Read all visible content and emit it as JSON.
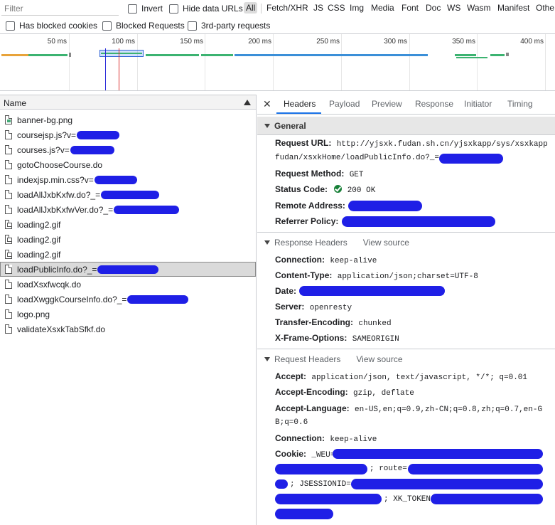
{
  "toolbar": {
    "filter_placeholder": "Filter",
    "invert_label": "Invert",
    "hide_data_urls_label": "Hide data URLs",
    "types": [
      "All",
      "Fetch/XHR",
      "JS",
      "CSS",
      "Img",
      "Media",
      "Font",
      "Doc",
      "WS",
      "Wasm",
      "Manifest",
      "Othe"
    ],
    "active_type": "All",
    "has_blocked_cookies_label": "Has blocked cookies",
    "blocked_requests_label": "Blocked Requests",
    "third_party_label": "3rd-party requests"
  },
  "overview": {
    "ticks": [
      "50 ms",
      "100 ms",
      "150 ms",
      "200 ms",
      "250 ms",
      "300 ms",
      "350 ms",
      "400 ms"
    ]
  },
  "request_list": {
    "column_name": "Name",
    "rows": [
      {
        "name": "banner-bg.png",
        "icon": "image-file-icon"
      },
      {
        "name": "coursejsp.js?v=",
        "icon": "file-icon"
      },
      {
        "name": "courses.js?v=",
        "icon": "file-icon"
      },
      {
        "name": "gotoChooseCourse.do",
        "icon": "file-icon"
      },
      {
        "name": "indexjsp.min.css?v=",
        "icon": "file-icon"
      },
      {
        "name": "loadAllJxbKxfw.do?_=",
        "icon": "file-icon"
      },
      {
        "name": "loadAllJxbKxfwVer.do?_=",
        "icon": "file-icon"
      },
      {
        "name": "loading2.gif",
        "icon": "gif-file-icon"
      },
      {
        "name": "loading2.gif",
        "icon": "gif-file-icon"
      },
      {
        "name": "loading2.gif",
        "icon": "gif-file-icon"
      },
      {
        "name": "loadPublicInfo.do?_=",
        "icon": "file-icon"
      },
      {
        "name": "loadXsxfwcqk.do",
        "icon": "file-icon"
      },
      {
        "name": "loadXwggkCourseInfo.do?_=",
        "icon": "file-icon"
      },
      {
        "name": "logo.png",
        "icon": "file-icon"
      },
      {
        "name": "validateXsxkTabSfkf.do",
        "icon": "file-icon"
      }
    ]
  },
  "details": {
    "tabs": [
      "Headers",
      "Payload",
      "Preview",
      "Response",
      "Initiator",
      "Timing"
    ],
    "active_tab": "Headers",
    "general": {
      "title": "General",
      "request_url_key": "Request URL:",
      "request_url_line1": "http://yjsxk.fudan.sh.cn/yjsxkapp/sys/xsxkapp",
      "request_url_line2": "fudan/xsxkHome/loadPublicInfo.do?_=",
      "request_method_key": "Request Method:",
      "request_method": "GET",
      "status_code_key": "Status Code:",
      "status_code": "200 OK",
      "remote_address_key": "Remote Address:",
      "referrer_policy_key": "Referrer Policy:"
    },
    "response_headers": {
      "title": "Response Headers",
      "view_source": "View source",
      "connection_key": "Connection:",
      "connection": "keep-alive",
      "content_type_key": "Content-Type:",
      "content_type": "application/json;charset=UTF-8",
      "date_key": "Date:",
      "server_key": "Server:",
      "server": "openresty",
      "transfer_encoding_key": "Transfer-Encoding:",
      "transfer_encoding": "chunked",
      "x_frame_options_key": "X-Frame-Options:",
      "x_frame_options": "SAMEORIGIN"
    },
    "request_headers": {
      "title": "Request Headers",
      "view_source": "View source",
      "accept_key": "Accept:",
      "accept": "application/json, text/javascript, */*; q=0.01",
      "accept_encoding_key": "Accept-Encoding:",
      "accept_encoding": "gzip, deflate",
      "accept_language_key": "Accept-Language:",
      "accept_language_line1": "en-US,en;q=0.9,zh-CN;q=0.8,zh;q=0.7,en-G",
      "accept_language_line2": "B;q=0.6",
      "connection_key": "Connection:",
      "connection": "keep-alive",
      "cookie_key": "Cookie:",
      "cookie_part1": "_WEU=",
      "cookie_part2": "; route=",
      "cookie_part3": "; JSESSIONID=",
      "cookie_part4": "; XK_TOKEN="
    }
  },
  "colors": {
    "accent": "#1a73e8",
    "redaction": "#1f1fe6",
    "status_ok": "#188038"
  }
}
